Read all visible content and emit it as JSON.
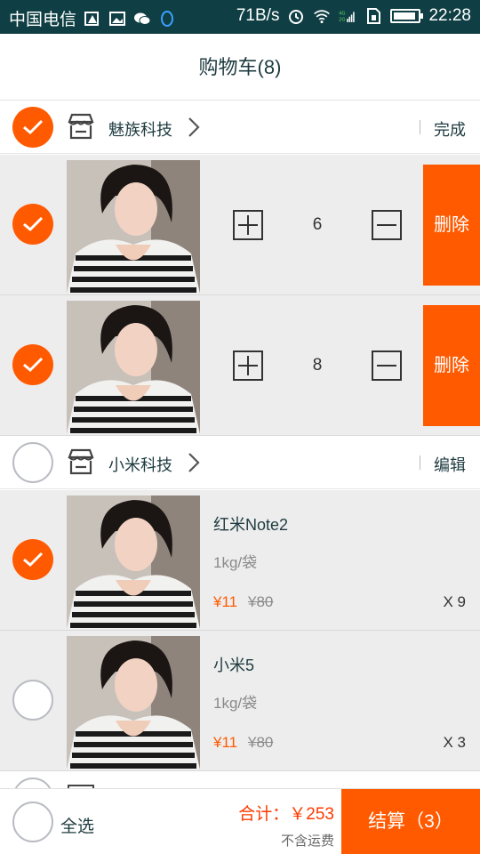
{
  "status_bar": {
    "carrier": "中国电信",
    "speed": "71B/s",
    "network": "4G 2G",
    "time": "22:28"
  },
  "header": {
    "title": "购物车(8)"
  },
  "colors": {
    "accent": "#ff5a00",
    "status_bar": "#0f3f44"
  },
  "shops": [
    {
      "name": "魅族科技",
      "action": "完成",
      "checked": true,
      "items": [
        {
          "quantity": "6",
          "delete_label": "删除",
          "checked": true
        },
        {
          "quantity": "8",
          "delete_label": "删除",
          "checked": true
        }
      ]
    },
    {
      "name": "小米科技",
      "action": "编辑",
      "checked": false,
      "items": [
        {
          "name": "红米Note2",
          "spec": "1kg/袋",
          "price": "¥11",
          "original_price": "¥80",
          "count": "X 9",
          "checked": true
        },
        {
          "name": "小米5",
          "spec": "1kg/袋",
          "price": "¥11",
          "original_price": "¥80",
          "count": "X 3",
          "checked": false
        }
      ]
    }
  ],
  "footer": {
    "select_all_label": "全选",
    "total": "合计：￥253",
    "shipping_note": "不含运费",
    "checkout_label": "结算（3）"
  }
}
